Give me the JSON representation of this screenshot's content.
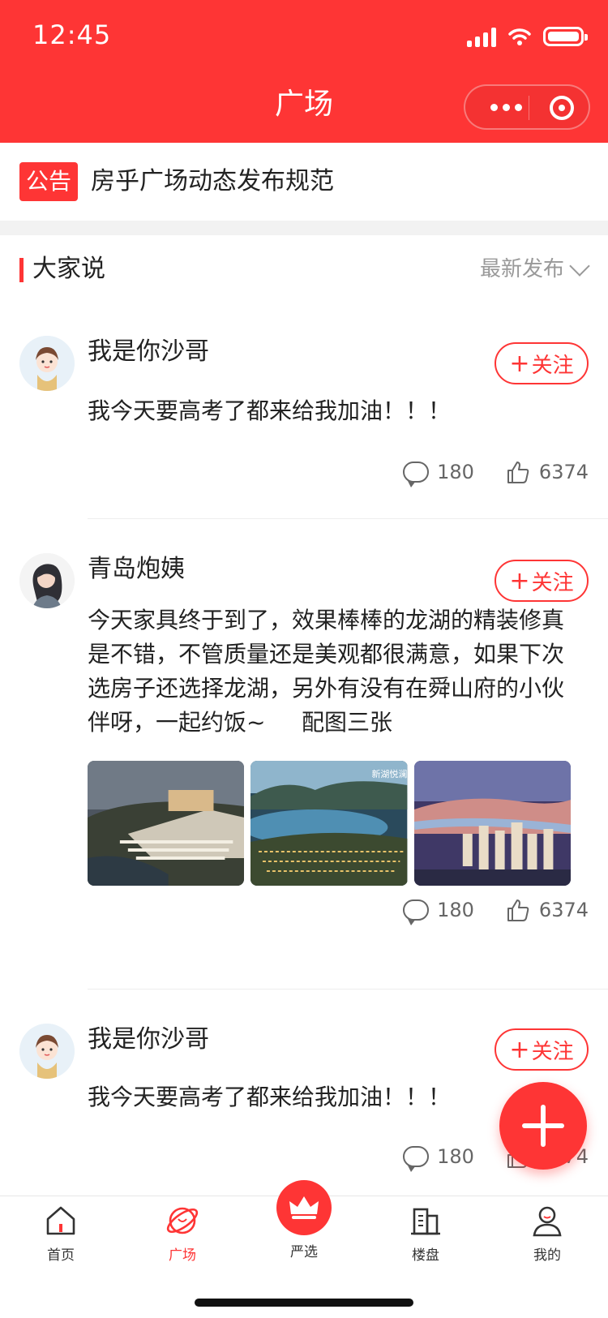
{
  "status": {
    "time": "12:45"
  },
  "nav": {
    "title": "广场"
  },
  "notice": {
    "tag": "公告",
    "text": "房乎广场动态发布规范"
  },
  "section": {
    "title": "大家说",
    "sort": "最新发布"
  },
  "posts": [
    {
      "user": "我是你沙哥",
      "follow": "关注",
      "text": "我今天要高考了都来给我加油！！！",
      "comments": "180",
      "likes": "6374"
    },
    {
      "user": "青岛炮姨",
      "follow": "关注",
      "text": "今天家具终于到了，效果棒棒的龙湖的精装修真是不错，不管质量还是美观都很满意，如果下次选房子还选择龙湖，另外有没有在舜山府的小伙伴呀，一起约饭~     配图三张",
      "comments": "180",
      "likes": "6374",
      "photo_watermark": "新湖悦澜"
    },
    {
      "user": "我是你沙哥",
      "follow": "关注",
      "text": "我今天要高考了都来给我加油！！！",
      "comments": "180",
      "likes": "6374"
    }
  ],
  "tabs": [
    {
      "label": "首页",
      "icon": "home-icon"
    },
    {
      "label": "广场",
      "icon": "planet-icon"
    },
    {
      "label": "严选",
      "icon": "crown-icon"
    },
    {
      "label": "楼盘",
      "icon": "building-icon"
    },
    {
      "label": "我的",
      "icon": "user-icon"
    }
  ],
  "colors": {
    "accent": "#fe3535",
    "text": "#222222",
    "muted": "#999999"
  }
}
